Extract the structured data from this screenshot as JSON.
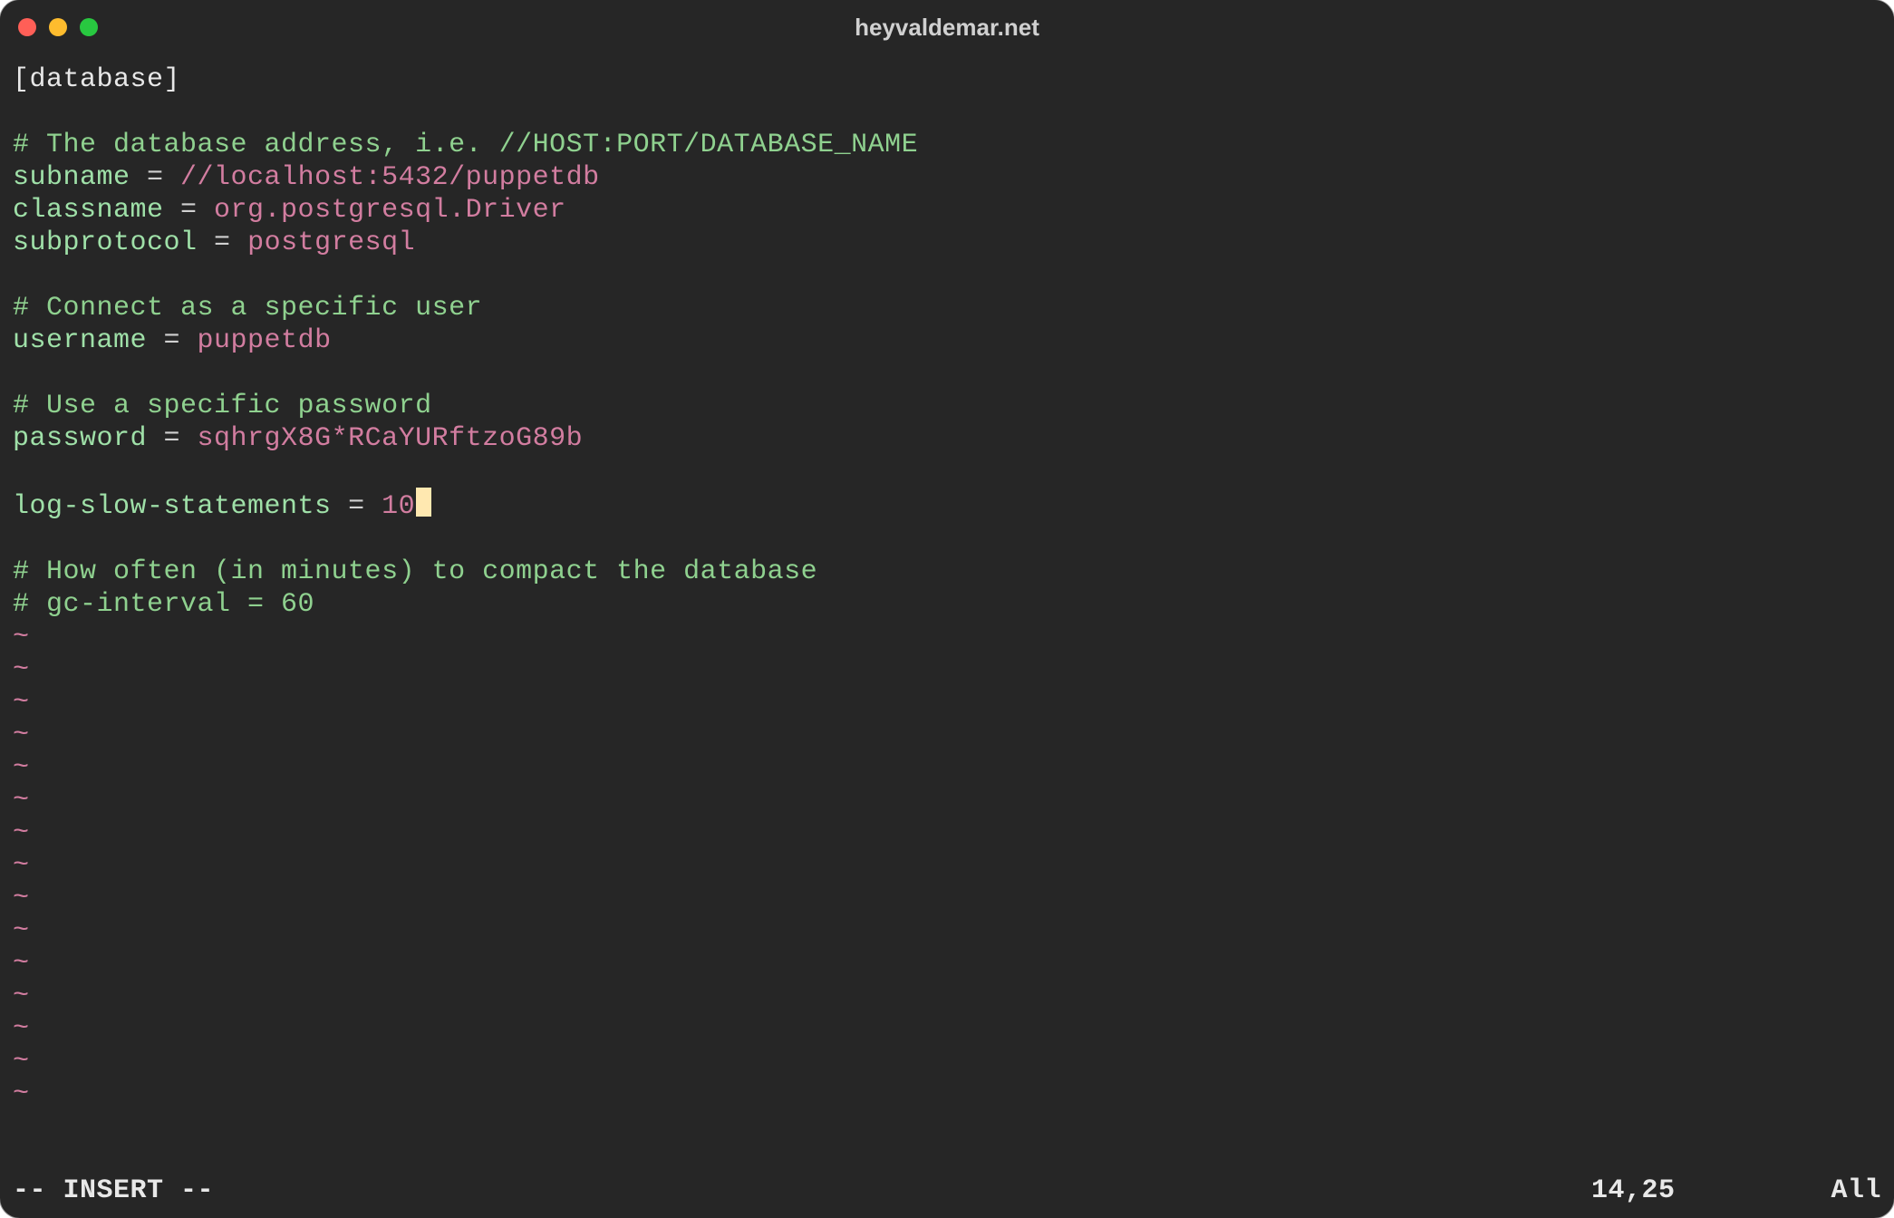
{
  "window": {
    "title": "heyvaldemar.net"
  },
  "editor": {
    "lines": [
      {
        "kind": "section",
        "text": "[database]"
      },
      {
        "kind": "blank"
      },
      {
        "kind": "comment",
        "text": "# The database address, i.e. //HOST:PORT/DATABASE_NAME"
      },
      {
        "kind": "kv",
        "key": "subname",
        "eq": " = ",
        "value": "//localhost:5432/puppetdb"
      },
      {
        "kind": "kv",
        "key": "classname",
        "eq": " = ",
        "value": "org.postgresql.Driver"
      },
      {
        "kind": "kv",
        "key": "subprotocol",
        "eq": " = ",
        "value": "postgresql"
      },
      {
        "kind": "blank"
      },
      {
        "kind": "comment",
        "text": "# Connect as a specific user"
      },
      {
        "kind": "kv",
        "key": "username",
        "eq": " = ",
        "value": "puppetdb"
      },
      {
        "kind": "blank"
      },
      {
        "kind": "comment",
        "text": "# Use a specific password"
      },
      {
        "kind": "kv",
        "key": "password",
        "eq": " = ",
        "value": "sqhrgX8G*RCaYURftzoG89b"
      },
      {
        "kind": "blank"
      },
      {
        "kind": "kv",
        "key": "log-slow-statements",
        "eq": " = ",
        "value": "10",
        "cursor_after": true
      },
      {
        "kind": "blank"
      },
      {
        "kind": "comment",
        "text": "# How often (in minutes) to compact the database"
      },
      {
        "kind": "comment",
        "text": "# gc-interval = 60"
      }
    ],
    "filler_glyph": "~",
    "filler_count": 15
  },
  "status": {
    "mode": "-- INSERT --",
    "position": "14,25",
    "percent": "All"
  },
  "colors": {
    "background": "#262626",
    "comment": "#8fd18f",
    "key": "#9fe0a8",
    "value": "#d27da0",
    "text": "#d0d0d0",
    "cursor": "#ffe8b0"
  }
}
